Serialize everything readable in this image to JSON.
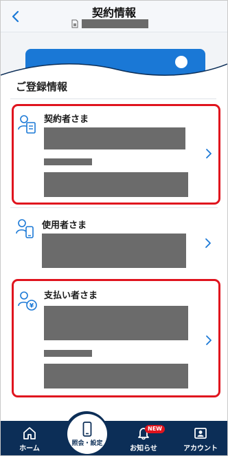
{
  "header": {
    "title": "契約情報",
    "back_icon": "chevron-left-icon",
    "sim_icon": "sim-card-icon"
  },
  "section": {
    "title": "ご登録情報"
  },
  "items": [
    {
      "label": "契約者さま",
      "icon": "contract-holder-icon",
      "highlighted": true
    },
    {
      "label": "使用者さま",
      "icon": "user-phone-icon",
      "highlighted": false
    },
    {
      "label": "支払い者さま",
      "icon": "payer-yen-icon",
      "highlighted": true
    }
  ],
  "bottom_nav": {
    "home": "ホーム",
    "inquiry_settings": "照会・設定",
    "notifications": "お知らせ",
    "notifications_badge": "NEW",
    "account": "アカウント"
  },
  "colors": {
    "accent": "#1a78d6",
    "nav_bg": "#0c2e57",
    "highlight": "#e0141e",
    "mask": "#6b6b6b"
  }
}
